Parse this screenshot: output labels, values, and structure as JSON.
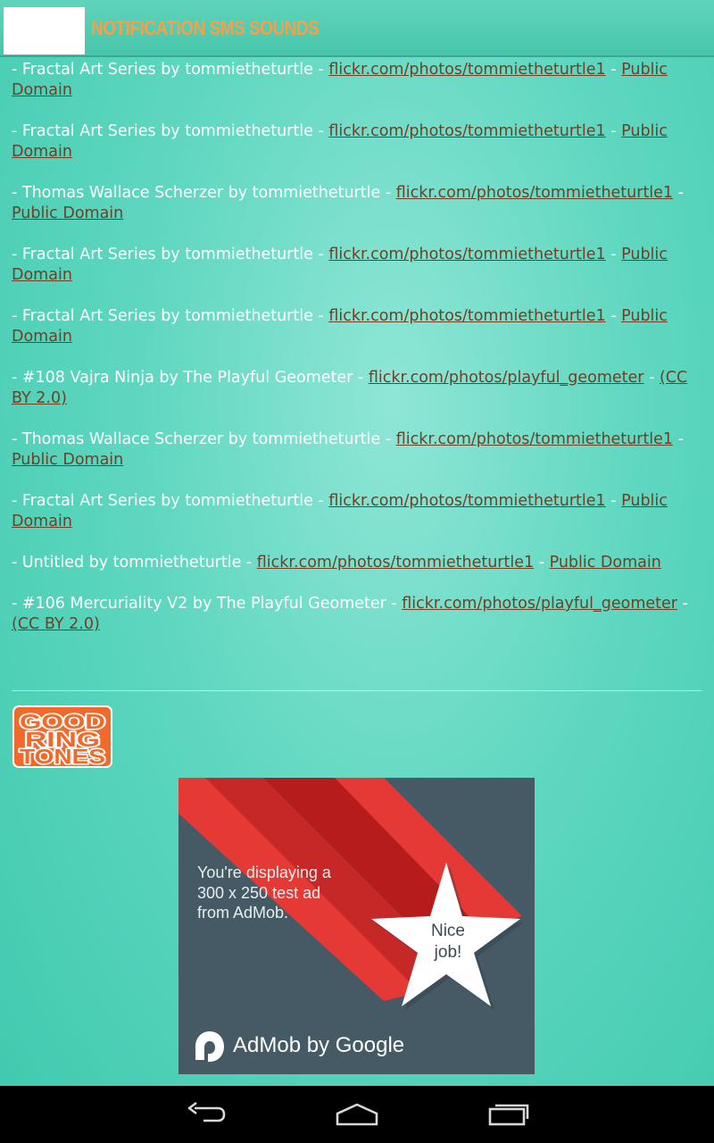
{
  "header": {
    "title": "NOTIFICATION SMS SOUNDS"
  },
  "credits": [
    {
      "text": "- Fractal Art Series by tommietheturtle - ",
      "link": "flickr.com/photos/tommietheturtle1",
      "sep": " - ",
      "license": "Public Domain"
    },
    {
      "text": "- Fractal Art Series by tommietheturtle - ",
      "link": "flickr.com/photos/tommietheturtle1",
      "sep": " - ",
      "license": "Public Domain"
    },
    {
      "text": "- Thomas Wallace Scherzer by tommietheturtle - ",
      "link": "flickr.com/photos/tommietheturtle1",
      "sep": " - ",
      "license": "Public Domain"
    },
    {
      "text": "- Fractal Art Series by tommietheturtle - ",
      "link": "flickr.com/photos/tommietheturtle1",
      "sep": " - ",
      "license": "Public Domain"
    },
    {
      "text": "- Fractal Art Series by tommietheturtle - ",
      "link": "flickr.com/photos/tommietheturtle1",
      "sep": " - ",
      "license": "Public Domain"
    },
    {
      "text": "- #108 Vajra Ninja by The Playful Geometer - ",
      "link": "flickr.com/photos/playful_geometer",
      "sep": " - ",
      "license": "(CC BY 2.0)"
    },
    {
      "text": "- Thomas Wallace Scherzer by tommietheturtle - ",
      "link": "flickr.com/photos/tommietheturtle1",
      "sep": " - ",
      "license": "Public Domain"
    },
    {
      "text": "- Fractal Art Series by tommietheturtle - ",
      "link": "flickr.com/photos/tommietheturtle1",
      "sep": " - ",
      "license": "Public Domain"
    },
    {
      "text": "- Untitled by tommietheturtle - ",
      "link": "flickr.com/photos/tommietheturtle1",
      "sep": " - ",
      "license": "Public Domain"
    },
    {
      "text": "- #106 Mercuriality V2 by The Playful Geometer - ",
      "link": "flickr.com/photos/playful_geometer",
      "sep": " - ",
      "license": "(CC BY 2.0)"
    }
  ],
  "logo": {
    "line1": "GOOD",
    "line2": "RING",
    "line3": "TONES"
  },
  "ad": {
    "message": "You're displaying a\n300 x 250 test ad\nfrom AdMob.",
    "star_text": "Nice\njob!",
    "brand": "AdMob by Google"
  },
  "navbar": {
    "back_icon": "back-icon",
    "home_icon": "home-icon",
    "recents_icon": "recents-icon"
  },
  "colors": {
    "background": "#5fd7c0",
    "title": "#f5a04a",
    "link": "#6b4226",
    "logo": "#f26a2b",
    "ad_background": "#455a64",
    "ad_stripe": "#e53935"
  }
}
